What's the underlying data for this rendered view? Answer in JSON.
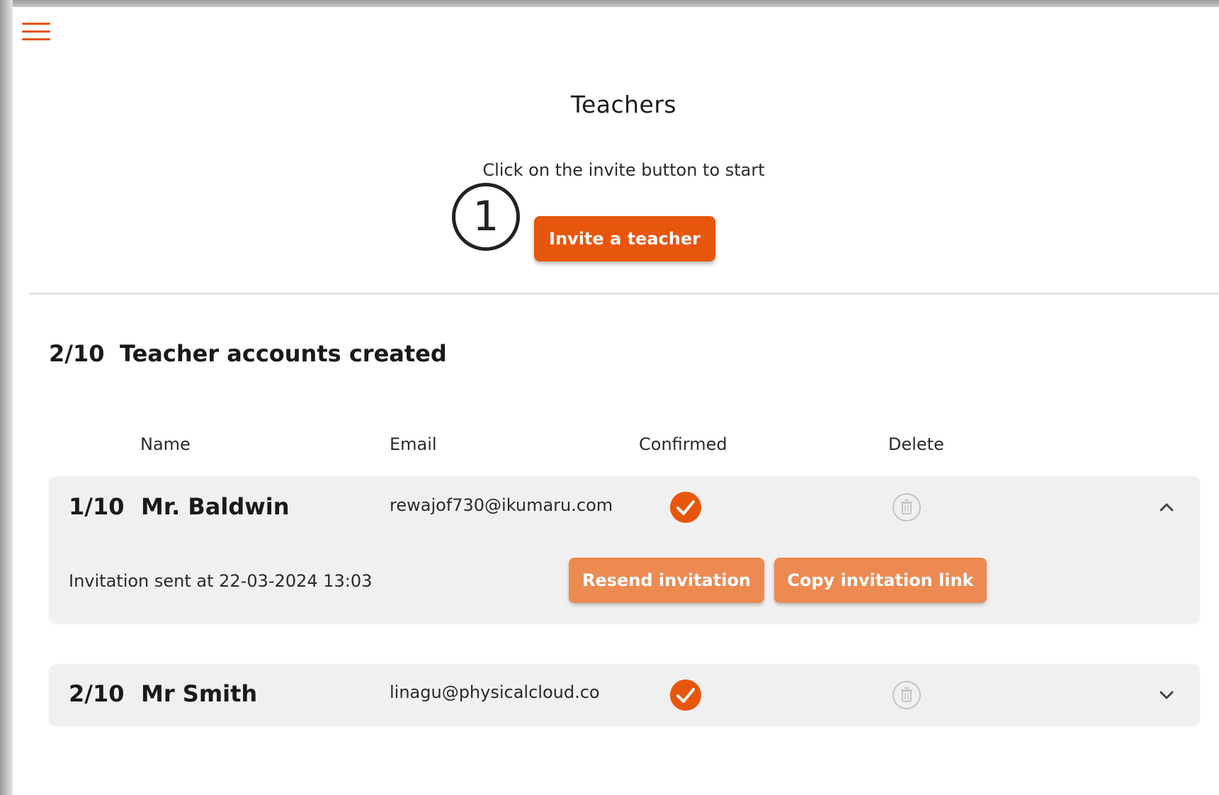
{
  "header": {
    "menu_icon": "hamburger-menu-icon",
    "title": "Teachers",
    "subtitle": "Click on the invite button to start",
    "step_number": "1",
    "invite_button_label": "Invite a teacher"
  },
  "summary": {
    "count": "2/10",
    "label": "Teacher accounts created"
  },
  "columns": {
    "name": "Name",
    "email": "Email",
    "confirmed": "Confirmed",
    "delete": "Delete"
  },
  "teachers": [
    {
      "index": "1/10",
      "name": "Mr. Baldwin",
      "email": "rewajof730@ikumaru.com",
      "confirmed": true,
      "expanded": true,
      "invitation_sent": "Invitation sent at 22-03-2024 13:03",
      "resend_label": "Resend invitation",
      "copy_link_label": "Copy invitation link"
    },
    {
      "index": "2/10",
      "name": "Mr Smith",
      "email": "linagu@physicalcloud.co",
      "confirmed": true,
      "expanded": false
    }
  ],
  "colors": {
    "accent": "#e8560d",
    "accent_light": "#ec8a52",
    "card_bg": "#f0f0f0"
  }
}
